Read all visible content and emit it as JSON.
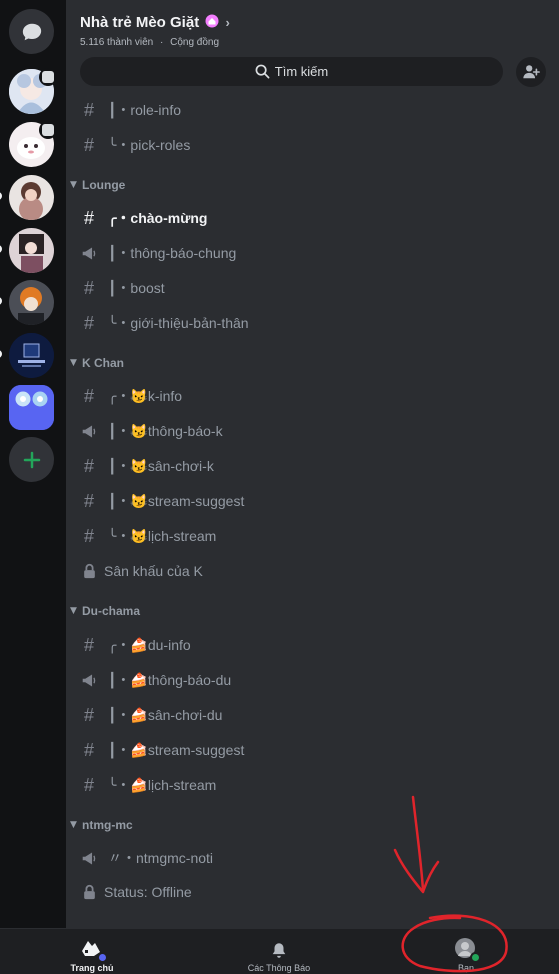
{
  "guild": {
    "name": "Nhà trẻ Mèo Giặt",
    "member_count": "5.116 thành viên",
    "separator": "·",
    "type": "Cộng đồng"
  },
  "search": {
    "label": "Tìm kiếm"
  },
  "categories": [
    {
      "name": "Lounge"
    },
    {
      "name": "K Chan"
    },
    {
      "name": "Du-chama"
    },
    {
      "name": "ntmg-mc"
    }
  ],
  "channels": {
    "role_info": "┃・role-info",
    "pick_roles": "╰・pick-roles",
    "chao_mung": "╭・chào-mừng",
    "thong_bao_chung": "┃・thông-báo-chung",
    "boost": "┃・boost",
    "gioi_thieu": "╰・giới-thiệu-bản-thân",
    "k_info": "╭・😼k-info",
    "thong_bao_k": "┃・😼thông-báo-k",
    "san_choi_k": "┃・😼sân-chơi-k",
    "stream_suggest_k": "┃・😼stream-suggest",
    "lich_stream_k": "╰・😼lịch-stream",
    "san_khau_k": "Sân khấu của K",
    "du_info": "╭・🍰du-info",
    "thong_bao_du": "┃・🍰thông-báo-du",
    "san_choi_du": "┃・🍰sân-chơi-du",
    "stream_suggest_du": "┃・🍰stream-suggest",
    "lich_stream_du": "╰・🍰lịch-stream",
    "ntmgmc_noti": "〃・ntmgmc-noti",
    "status_offline": "Status: Offline"
  },
  "icons": {
    "hash": "#",
    "lock": "lock-icon",
    "megaphone": "megaphone-icon"
  },
  "bottom_nav": {
    "home": "Trang chủ",
    "notifications": "Các Thông Báo",
    "you": "Bạn"
  },
  "colors": {
    "panel": "#2b2d31",
    "rail": "#111214",
    "accent": "#5865f2",
    "online": "#23a55a",
    "annotation": "#e0242b"
  }
}
